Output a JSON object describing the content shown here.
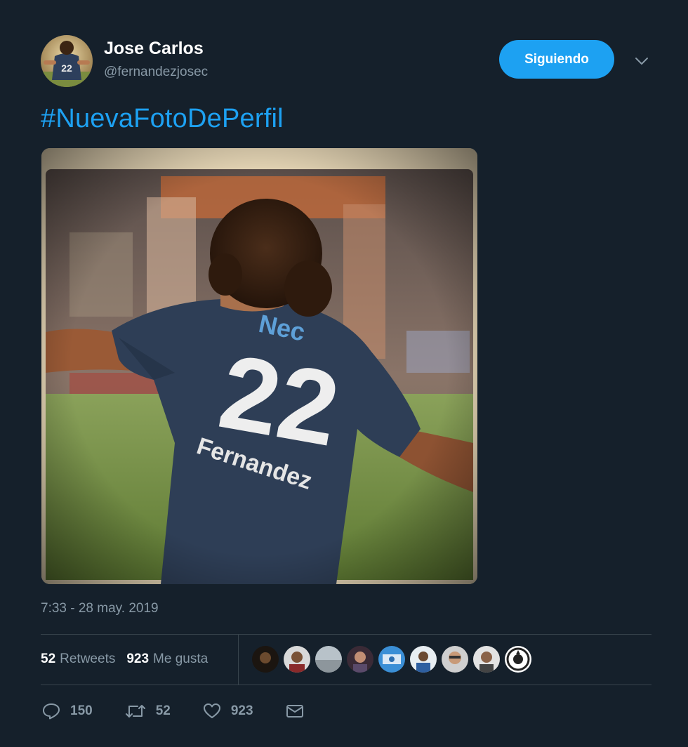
{
  "tweet": {
    "author": {
      "display_name": "Jose Carlos",
      "handle": "@fernandezjosec",
      "avatar_icon": "profile-photo-footballer-22"
    },
    "follow_button_label": "Siguiendo",
    "menu_icon": "chevron-down-icon",
    "text": "#NuevaFotoDePerfil",
    "photo": {
      "jersey_number": "22",
      "jersey_name": "fernandez",
      "sponsor": "Nec"
    },
    "timestamp": "7:33 - 28 may. 2019",
    "stats": {
      "retweets_count": "52",
      "retweets_label": "Retweets",
      "likes_count": "923",
      "likes_label": "Me gusta"
    },
    "liker_avatars": [
      "liker-1",
      "liker-2",
      "liker-3",
      "liker-4",
      "liker-5",
      "liker-6",
      "liker-7",
      "liker-8",
      "liker-9"
    ],
    "actions": {
      "reply_count": "150",
      "retweet_count": "52",
      "like_count": "923"
    }
  },
  "colors": {
    "background": "#15202b",
    "accent": "#1da1f2",
    "secondary_text": "#8899a6",
    "divider": "#38444d"
  }
}
